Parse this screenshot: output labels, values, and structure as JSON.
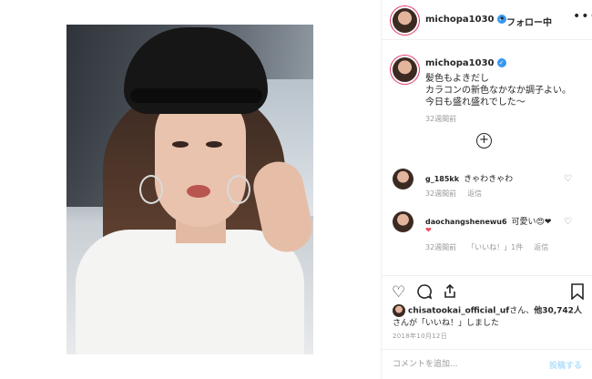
{
  "header": {
    "username": "michopa1030",
    "verified_mark": "✓",
    "separator": "•",
    "follow_status": "フォロー中",
    "more_icon": "more-icon"
  },
  "caption": {
    "username": "michopa1030",
    "period": ".",
    "lines": [
      "髪色もよきだし",
      "カラコンの新色なかなか調子よい。",
      "今日も盛れ盛れでした〜"
    ],
    "time_ago": "32週間前"
  },
  "load_more": "+",
  "comments": [
    {
      "username": "g_185kk",
      "text": "きゃわきゃわ",
      "time_ago": "32週間前",
      "reply": "返信"
    },
    {
      "username": "daochangshenewu6",
      "text": "可愛い😍❤",
      "heart": "❤",
      "time_ago": "32週間前",
      "likes": "「いいね！」1件",
      "reply": "返信"
    }
  ],
  "likes": {
    "user": "chisatookai_official_uf",
    "mid": "さん、",
    "count": "他30,742人",
    "tail": "さんが「いいね！」しました"
  },
  "date": "2018年10月12日",
  "add_comment": {
    "placeholder": "コメントを追加...",
    "post_label": "投稿する"
  },
  "icons": [
    "heart-icon",
    "comment-icon",
    "share-icon",
    "bookmark-icon"
  ]
}
